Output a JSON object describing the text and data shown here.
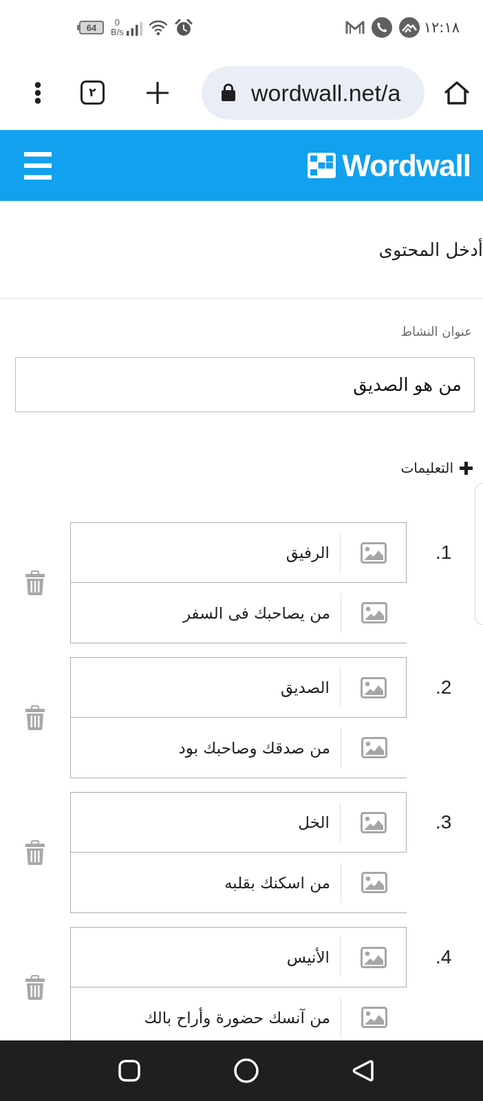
{
  "status_bar": {
    "battery": "64",
    "data_rate": {
      "value": "0",
      "unit": "B/s"
    },
    "time": "١٢:١٨"
  },
  "browser": {
    "tab_count": "٢",
    "url": "wordwall.net/a"
  },
  "header": {
    "logo_text": "Wordwall"
  },
  "page": {
    "title": "أدخل المحتوى",
    "activity_title": {
      "label": "عنوان النشاط",
      "value": "من هو الصديق"
    },
    "instructions": {
      "label": "التعليمات",
      "expanded": false
    }
  },
  "items": [
    {
      "number": "1.",
      "term": "الرفيق",
      "definition": "من يصاحبك فى السفر"
    },
    {
      "number": "2.",
      "term": "الصديق",
      "definition": "من صدقك وصاحبك بود"
    },
    {
      "number": "3.",
      "term": "الخل",
      "definition": "من اسكنك بقلبه"
    },
    {
      "number": "4.",
      "term": "الأنيس",
      "definition": "من آنسك حضورة وأراح بالك"
    }
  ]
}
